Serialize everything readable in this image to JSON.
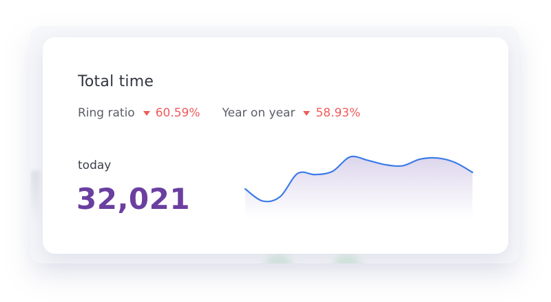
{
  "card": {
    "title": "Total time",
    "metrics": [
      {
        "label": "Ring ratio",
        "trend": "down",
        "value": "60.59%"
      },
      {
        "label": "Year on year",
        "trend": "down",
        "value": "58.93%"
      }
    ],
    "period_label": "today",
    "total": "32,021"
  },
  "colors": {
    "accent_purple": "#6a3fa0",
    "decrease_red": "#ee5b5b",
    "line_blue": "#3b7be8",
    "area_fill_top": "#dcd5ec"
  },
  "icons": {
    "trend_down": "triangle-down-icon"
  },
  "chart_data": {
    "type": "area",
    "series": [
      {
        "values": [
          40,
          18,
          26,
          68,
          66,
          72,
          98,
          92,
          84,
          82,
          94,
          96,
          88,
          70
        ]
      }
    ],
    "title": "",
    "xlabel": "",
    "ylabel": "",
    "ylim": [
      0,
      100
    ],
    "grid": false
  }
}
